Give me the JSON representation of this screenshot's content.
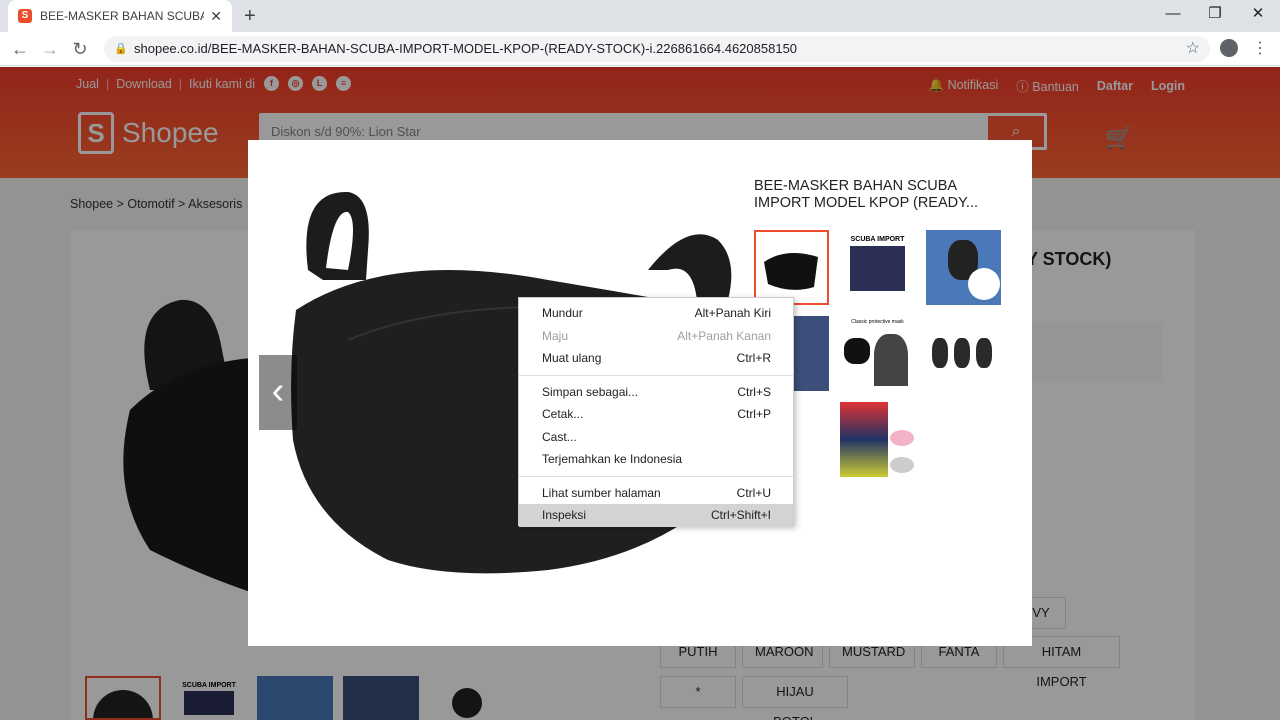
{
  "browser": {
    "tab_title": "BEE-MASKER BAHAN SCUBA IMP",
    "tab_favicon": "S",
    "tab_close": "✕",
    "new_tab": "+",
    "url": "shopee.co.id/BEE-MASKER-BAHAN-SCUBA-IMPORT-MODEL-KPOP-(READY-STOCK)-i.226861664.4620858150",
    "controls": {
      "minimize": "—",
      "restore": "❐",
      "close": "✕"
    },
    "nav": {
      "back": "←",
      "forward": "→",
      "reload": "↻"
    },
    "icons": {
      "lock": "lock-icon",
      "star": "star-icon",
      "profile": "profile-icon",
      "menu": "kebab-icon"
    }
  },
  "header": {
    "links": [
      "Jual",
      "Download",
      "Ikuti kami di"
    ],
    "social_icons": [
      "f",
      "◎",
      "L",
      "≡"
    ],
    "right": {
      "notif": "Notifikasi",
      "help": "Bantuan",
      "register": "Daftar",
      "login": "Login"
    },
    "logo_letter": "S",
    "logo_text": "Shopee",
    "search_placeholder": "Diskon s/d 90%: Lion Star",
    "search_icon": "⌕",
    "cart_icon": "🛒"
  },
  "breadcrumb": "Shopee  >  Otomotif  >  Aksesoris",
  "product_title_partial": "DY STOCK)",
  "variants_row1": [
    "PUTIH",
    "MAROON",
    "MUSTARD",
    "FANTA",
    "HITAM IMPORT"
  ],
  "variants_row2": [
    "*",
    "HIJAU BOTOL"
  ],
  "variant_partial": "VY",
  "modal": {
    "title": "BEE-MASKER BAHAN SCUBA IMPORT MODEL KPOP (READY...",
    "prev_arrow": "‹",
    "thumb_labels": {
      "scuba": "SCUBA IMPORT",
      "classic": "Classic protective mask"
    }
  },
  "context_menu": {
    "group1": [
      {
        "label": "Mundur",
        "shortcut": "Alt+Panah Kiri"
      },
      {
        "label": "Maju",
        "shortcut": "Alt+Panah Kanan"
      },
      {
        "label": "Muat ulang",
        "shortcut": "Ctrl+R"
      }
    ],
    "group2": [
      {
        "label": "Simpan sebagai...",
        "shortcut": "Ctrl+S"
      },
      {
        "label": "Cetak...",
        "shortcut": "Ctrl+P"
      },
      {
        "label": "Cast...",
        "shortcut": ""
      },
      {
        "label": "Terjemahkan ke Indonesia",
        "shortcut": ""
      }
    ],
    "group3": [
      {
        "label": "Lihat sumber halaman",
        "shortcut": "Ctrl+U"
      },
      {
        "label": "Inspeksi",
        "shortcut": "Ctrl+Shift+I"
      }
    ]
  },
  "colors": {
    "brand": "#ee4d2d",
    "header_top": "#f53d2d"
  }
}
